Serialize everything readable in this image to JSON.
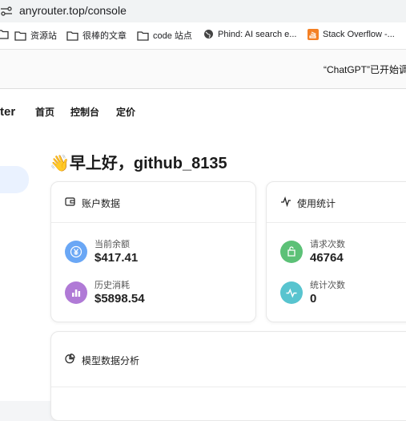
{
  "browser": {
    "url": "anyrouter.top/console"
  },
  "bookmarks": [
    {
      "label": "",
      "icon": "folder-icon"
    },
    {
      "label": "资源站",
      "icon": "folder-icon"
    },
    {
      "label": "很棒的文章",
      "icon": "folder-icon"
    },
    {
      "label": "code 站点",
      "icon": "folder-icon"
    },
    {
      "label": "Phind: AI search e...",
      "icon": "globe-icon"
    },
    {
      "label": "Stack Overflow -...",
      "icon": "stackoverflow-icon"
    }
  ],
  "notice": {
    "text": "“ChatGPT”已开始调"
  },
  "nav": {
    "brand": "ter",
    "links": [
      "首页",
      "控制台",
      "定价"
    ]
  },
  "greeting": "👋早上好，github_8135",
  "account_card": {
    "title": "账户数据",
    "stats": [
      {
        "label": "当前余额",
        "value": "$417.41",
        "icon": "yen-icon",
        "color": "#6aa7f5"
      },
      {
        "label": "历史消耗",
        "value": "$5898.54",
        "icon": "bar-chart-icon",
        "color": "#b07ad6"
      }
    ]
  },
  "usage_card": {
    "title": "使用统计",
    "stats": [
      {
        "label": "请求次数",
        "value": "46764",
        "icon": "send-icon",
        "color": "#5cc177"
      },
      {
        "label": "统计次数",
        "value": "0",
        "icon": "pulse-icon",
        "color": "#58c4cf"
      }
    ]
  },
  "model_card": {
    "title": "模型数据分析"
  }
}
